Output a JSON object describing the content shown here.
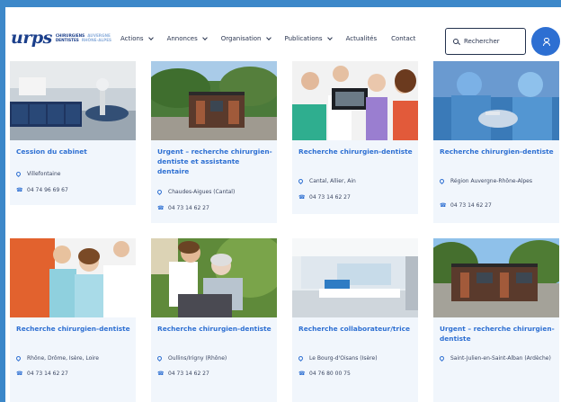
{
  "header": {
    "logo": {
      "mark": "urps",
      "line1a": "CHIRURGIENS",
      "line1b": "AUVERGNE",
      "line2a": "DENTISTES",
      "line2b": "RHÔNE-ALPES"
    },
    "nav": [
      {
        "label": "Actions",
        "dropdown": true
      },
      {
        "label": "Annonces",
        "dropdown": true
      },
      {
        "label": "Organisation",
        "dropdown": true
      },
      {
        "label": "Publications",
        "dropdown": true
      },
      {
        "label": "Actualités",
        "dropdown": false
      },
      {
        "label": "Contact",
        "dropdown": false
      }
    ],
    "search_label": "Rechercher"
  },
  "cards": [
    {
      "title": "Cession du cabinet",
      "location": "Villefontaine",
      "phone": "04 74 96 69 67"
    },
    {
      "title": "Urgent – recherche chirurgien-dentiste et assistante dentaire",
      "location": "Chaudes-Aigues (Cantal)",
      "phone": "04 73 14 62 27"
    },
    {
      "title": "Recherche chirurgien-dentiste",
      "location": "Cantal, Allier, Ain",
      "phone": "04 73 14 62 27"
    },
    {
      "title": "Recherche chirurgien-dentiste",
      "location": "Région Auvergne-Rhône-Alpes",
      "phone": "04 73 14 62 27"
    },
    {
      "title": "Recherche chirurgien-dentiste",
      "location": "Rhône, Drôme, Isère, Loire",
      "phone": "04 73 14 62 27"
    },
    {
      "title": "Recherche chirurgien-dentiste",
      "location": "Oullins/Irigny (Rhône)",
      "phone": "04 73 14 62 27"
    },
    {
      "title": "Recherche collaborateur/trice",
      "location": "Le Bourg-d'Oisans (Isère)",
      "phone": "04 76 80 00 75"
    },
    {
      "title": "Urgent – recherche chirurgien-dentiste",
      "location": "Saint-Julien-en-Saint-Alban (Ardèche)",
      "phone": "04 73 14 62 27"
    }
  ]
}
